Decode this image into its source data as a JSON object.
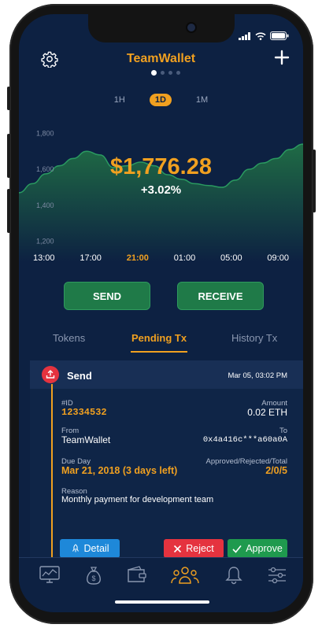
{
  "app": {
    "title": "TeamWallet"
  },
  "status_bar": {
    "icons": [
      "signal-icon",
      "wifi-icon",
      "battery-icon"
    ]
  },
  "header": {
    "settings_icon": "gear-icon",
    "add_icon": "plus-icon",
    "pages": 4,
    "active_page": 1
  },
  "ranges": {
    "options": [
      "1H",
      "1D",
      "1M"
    ],
    "selected": "1D"
  },
  "balance": {
    "amount": "$1,776.28",
    "change": "+3.02%"
  },
  "chart_data": {
    "type": "area",
    "x": [
      "13:00",
      "14:00",
      "15:00",
      "16:00",
      "17:00",
      "18:00",
      "19:00",
      "20:00",
      "21:00",
      "22:00",
      "23:00",
      "00:00",
      "01:00",
      "02:00",
      "03:00",
      "04:00",
      "05:00",
      "06:00",
      "07:00",
      "08:00",
      "09:00",
      "10:00"
    ],
    "values": [
      1470,
      1520,
      1575,
      1620,
      1660,
      1700,
      1680,
      1610,
      1620,
      1640,
      1620,
      1570,
      1545,
      1520,
      1510,
      1500,
      1540,
      1600,
      1635,
      1660,
      1710,
      1740
    ],
    "xticks": [
      "13:00",
      "17:00",
      "21:00",
      "01:00",
      "05:00",
      "09:00"
    ],
    "selected_tick": "21:00",
    "yticks": [
      "1,800",
      "1,600",
      "1,400",
      "1,200"
    ],
    "ylim": [
      1150,
      1850
    ],
    "fill": "#1f6b45",
    "line": "#2a9a60"
  },
  "actions": {
    "send": "SEND",
    "receive": "RECEIVE"
  },
  "tabs": {
    "items": [
      "Tokens",
      "Pending Tx",
      "History Tx"
    ],
    "selected": "Pending Tx"
  },
  "tx": {
    "type": "Send",
    "date": "Mar 05, 03:02 PM",
    "id_label": "#ID",
    "id": "12334532",
    "amount_label": "Amount",
    "amount": "0.02 ETH",
    "from_label": "From",
    "from": "TeamWallet",
    "to_label": "To",
    "to": "0x4a416c***a60a0A",
    "due_label": "Due Day",
    "due": "Mar 21, 2018 (3 days left)",
    "approval_label": "Approved/Rejected/Total",
    "approval": "2/0/5",
    "reason_label": "Reason",
    "reason": "Monthly payment for development team",
    "detail_label": "Detail",
    "reject_label": "Reject",
    "approve_label": "Approve"
  },
  "nav": {
    "icons": [
      "chart-monitor-icon",
      "money-bag-icon",
      "wallet-icon",
      "team-icon",
      "bell-icon",
      "sliders-icon"
    ],
    "active": "team-icon"
  },
  "colors": {
    "accent": "#f0a020",
    "background": "#0d2142",
    "green": "#1f7a48",
    "red": "#e5333f",
    "blue": "#1e88d9"
  }
}
